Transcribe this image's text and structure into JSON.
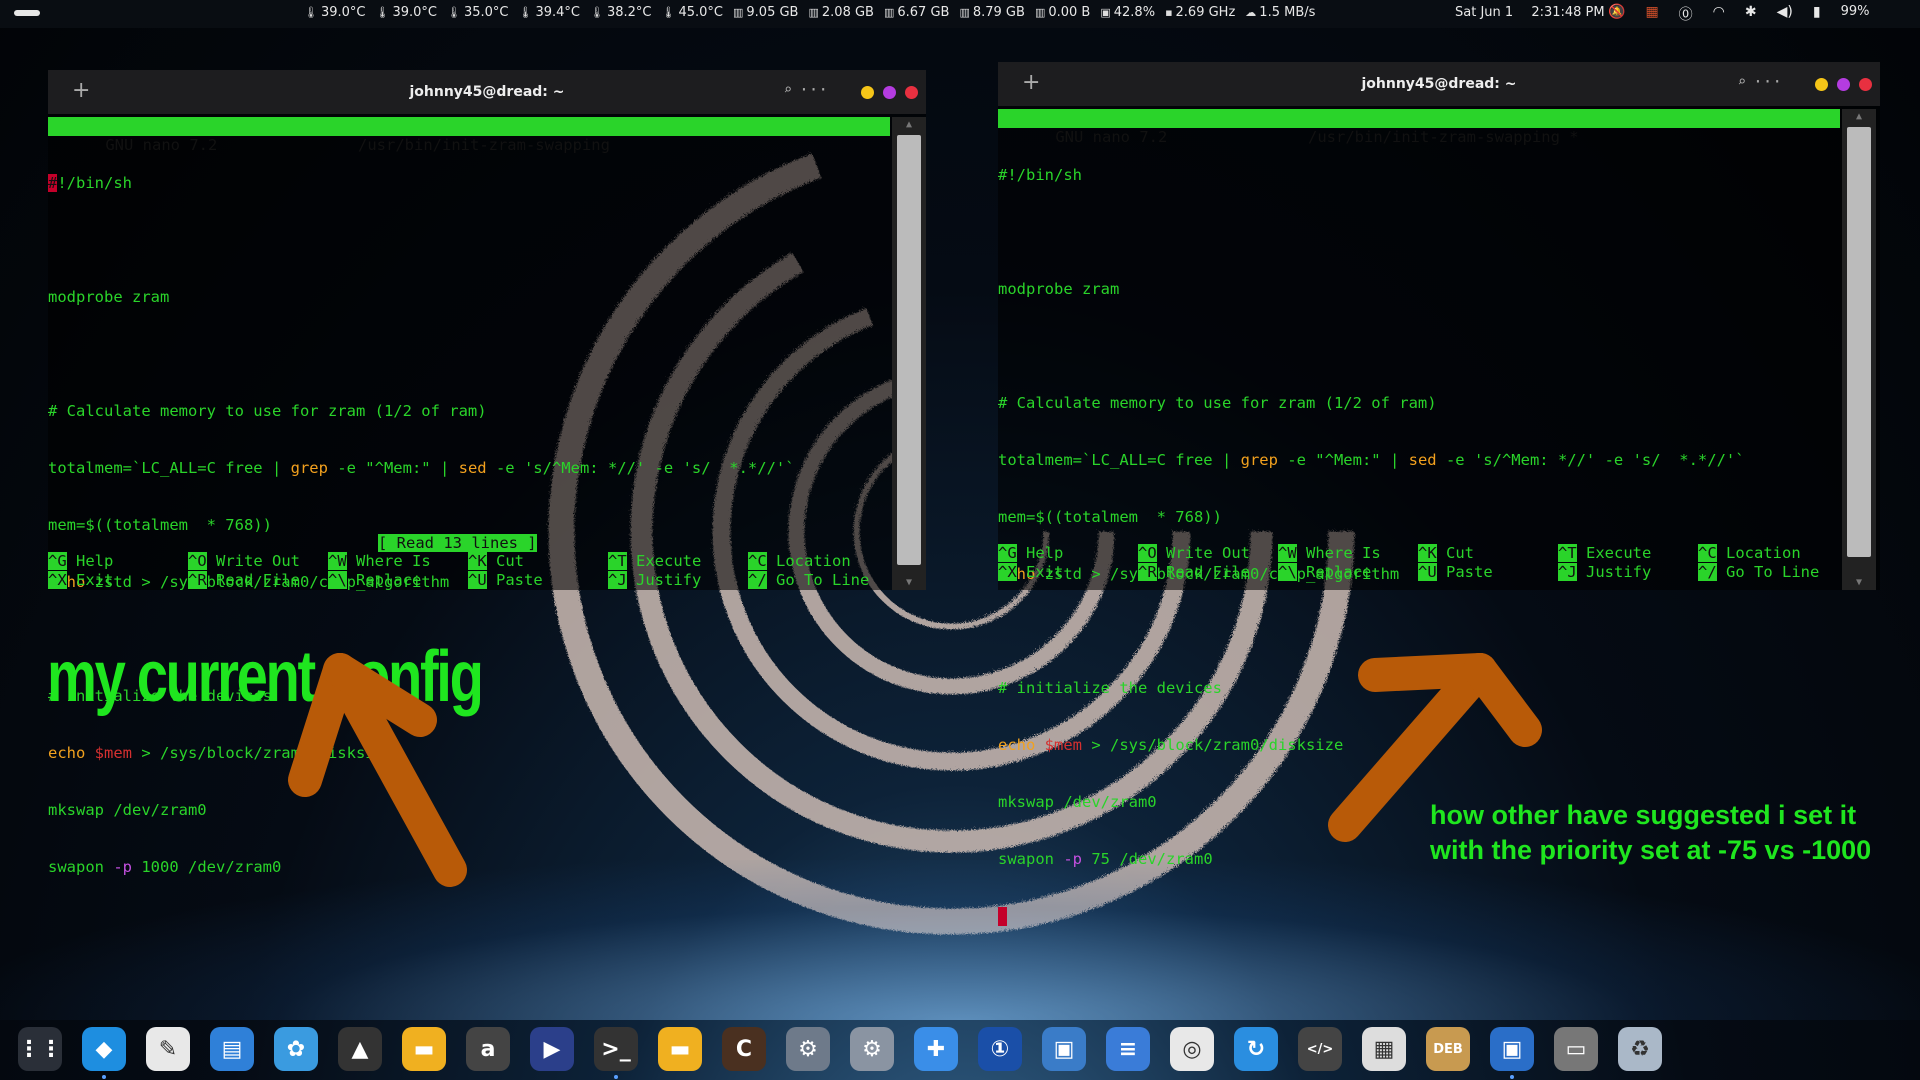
{
  "topbar": {
    "stats": [
      {
        "icon": "thermometer-icon",
        "value": "39.0°C"
      },
      {
        "icon": "thermometer-icon",
        "value": "39.0°C"
      },
      {
        "icon": "thermometer-icon",
        "value": "35.0°C"
      },
      {
        "icon": "thermometer-icon",
        "value": "39.4°C"
      },
      {
        "icon": "thermometer-icon",
        "value": "38.2°C"
      },
      {
        "icon": "thermometer-icon",
        "value": "45.0°C"
      },
      {
        "icon": "memory-icon",
        "value": "9.05 GB"
      },
      {
        "icon": "memory-icon",
        "value": "2.08 GB"
      },
      {
        "icon": "memory-icon",
        "value": "6.67 GB"
      },
      {
        "icon": "memory-icon",
        "value": "8.79 GB"
      },
      {
        "icon": "memory-icon",
        "value": "0.00 B"
      },
      {
        "icon": "cpu-icon",
        "value": "42.8%"
      },
      {
        "icon": "cpu-freq-icon",
        "value": "2.69 GHz"
      },
      {
        "icon": "network-icon",
        "value": "1.5 MB/s"
      }
    ],
    "date": "Sat Jun 1",
    "time": "2:31:48 PM",
    "battery": "99%"
  },
  "left_window": {
    "title": "johnny45@dread: ~",
    "nano_version": "GNU nano 7.2",
    "file": "/usr/bin/init-zram-swapping",
    "status_msg": "[ Read 13 lines ]",
    "lines": {
      "l1": "#!/bin/sh",
      "l3": "modprobe zram",
      "l5": "# Calculate memory to use for zram (1/2 of ram)",
      "l6a": "totalmem=`LC_ALL=C free | ",
      "l6b": "grep",
      "l6c": " -e \"^Mem:\" | ",
      "l6d": "sed",
      "l6e": " -e 's/^Mem: *//' -e 's/  *.*//'`",
      "l7": "mem=$((totalmem  * 768))",
      "l8a": "echo",
      "l8b": " zstd > /sys/block/zram0/comp_algorithm",
      "l10": "# initialize the devices",
      "l11a": "echo",
      "l11b": " $mem",
      "l11c": " > /sys/block/zram0/disksize",
      "l12": "mkswap /dev/zram0",
      "l13a": "swapon ",
      "l13b": "-p",
      "l13c": " 1000 /dev/zram0"
    }
  },
  "right_window": {
    "title": "johnny45@dread: ~",
    "nano_version": "GNU nano 7.2",
    "file": "/usr/bin/init-zram-swapping *",
    "lines": {
      "l1": "#!/bin/sh",
      "l3": "modprobe zram",
      "l5": "# Calculate memory to use for zram (1/2 of ram)",
      "l6a": "totalmem=`LC_ALL=C free | ",
      "l6b": "grep",
      "l6c": " -e \"^Mem:\" | ",
      "l6d": "sed",
      "l6e": " -e 's/^Mem: *//' -e 's/  *.*//'`",
      "l7": "mem=$((totalmem  * 768))",
      "l8a": "echo",
      "l8b": " zstd > /sys/block/zram0/comp_algorithm",
      "l10": "# initialize the devices",
      "l11a": "echo",
      "l11b": " $mem",
      "l11c": " > /sys/block/zram0/disksize",
      "l12": "mkswap /dev/zram0",
      "l13a": "swapon ",
      "l13b": "-p",
      "l13c": " 75 /dev/zram0"
    }
  },
  "nano_keys": {
    "row1": [
      {
        "key": "^G",
        "label": "Help"
      },
      {
        "key": "^O",
        "label": "Write Out"
      },
      {
        "key": "^W",
        "label": "Where Is"
      },
      {
        "key": "^K",
        "label": "Cut"
      },
      {
        "key": "^T",
        "label": "Execute"
      },
      {
        "key": "^C",
        "label": "Location"
      }
    ],
    "row2": [
      {
        "key": "^X",
        "label": "Exit"
      },
      {
        "key": "^R",
        "label": "Read File"
      },
      {
        "key": "^\\",
        "label": "Replace"
      },
      {
        "key": "^U",
        "label": "Paste"
      },
      {
        "key": "^J",
        "label": "Justify"
      },
      {
        "key": "^/",
        "label": "Go To Line"
      }
    ]
  },
  "annotations": {
    "left": "my current config",
    "right_line1": "how other have suggested i set it",
    "right_line2": "with the priority set at -75 vs -1000"
  },
  "colors": {
    "nano_green": "#2ad42a",
    "annotation_green": "#1fe61f",
    "arrow_orange": "#b85a08"
  },
  "dock": [
    {
      "name": "app-grid-icon",
      "glyph": "⋮⋮",
      "color": "#2a2f38"
    },
    {
      "name": "browser-icon",
      "glyph": "◆",
      "color": "#1e8ee0"
    },
    {
      "name": "text-editor-icon",
      "glyph": "✎",
      "color": "#e8e8e8"
    },
    {
      "name": "files-icon",
      "glyph": "▤",
      "color": "#2f80d8"
    },
    {
      "name": "paint-icon",
      "glyph": "✿",
      "color": "#3a9be0"
    },
    {
      "name": "inkscape-icon",
      "glyph": "▲",
      "color": "#333"
    },
    {
      "name": "folder-icon",
      "glyph": "▬",
      "color": "#f0b020"
    },
    {
      "name": "font-icon",
      "glyph": "a",
      "color": "#444"
    },
    {
      "name": "video-editor-icon",
      "glyph": "▶",
      "color": "#2b3f8a"
    },
    {
      "name": "terminal-icon",
      "glyph": ">_",
      "color": "#333"
    },
    {
      "name": "folder-icon-2",
      "glyph": "▬",
      "color": "#f0b020"
    },
    {
      "name": "cpu-x-icon",
      "glyph": "C",
      "color": "#4a3020"
    },
    {
      "name": "settings-icon",
      "glyph": "⚙",
      "color": "#6e7a8a"
    },
    {
      "name": "settings-icon-2",
      "glyph": "⚙",
      "color": "#8a94a2"
    },
    {
      "name": "extensions-icon",
      "glyph": "✚",
      "color": "#3a8ee8"
    },
    {
      "name": "password-manager-icon",
      "glyph": "①",
      "color": "#1a4fa8"
    },
    {
      "name": "remote-desktop-icon",
      "glyph": "▣",
      "color": "#3a7cc8"
    },
    {
      "name": "equalizer-icon",
      "glyph": "≡",
      "color": "#3a7cd8"
    },
    {
      "name": "disk-usage-icon",
      "glyph": "◎",
      "color": "#e8e8e8"
    },
    {
      "name": "sync-icon",
      "glyph": "↻",
      "color": "#2a8ee0"
    },
    {
      "name": "code-icon",
      "glyph": "</>",
      "color": "#444"
    },
    {
      "name": "window-manager-icon",
      "glyph": "▦",
      "color": "#ddd"
    },
    {
      "name": "deb-installer-icon",
      "glyph": "DEB",
      "color": "#c89a50"
    },
    {
      "name": "store-icon",
      "glyph": "▣",
      "color": "#2a6ec8"
    },
    {
      "name": "drive-icon",
      "glyph": "▭",
      "color": "#777"
    },
    {
      "name": "trash-icon",
      "glyph": "♻",
      "color": "#aab8c8"
    }
  ]
}
